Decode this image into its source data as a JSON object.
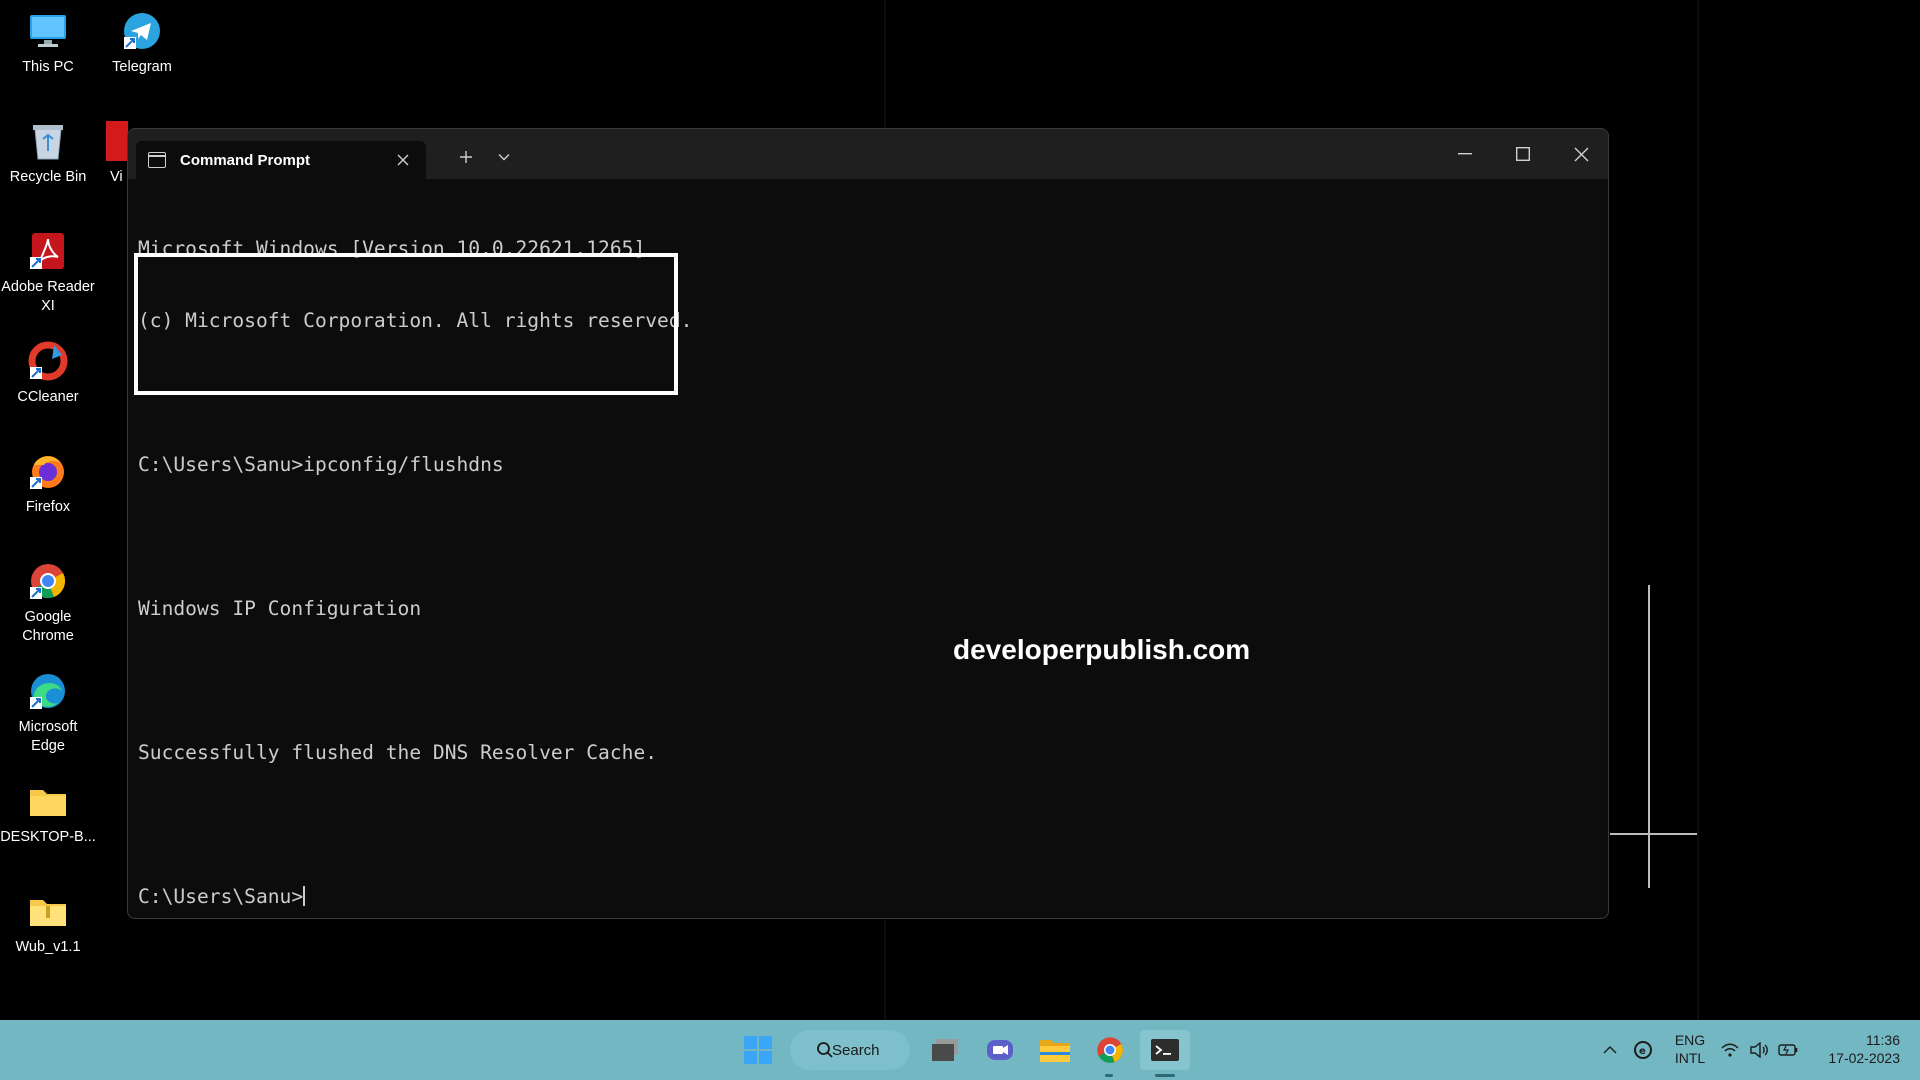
{
  "desktop": {
    "icons": [
      {
        "label": "This PC"
      },
      {
        "label": "Telegram"
      },
      {
        "label": "Recycle Bin"
      },
      {
        "label": "Vi"
      },
      {
        "label": "Adobe Reader XI"
      },
      {
        "label": "CCleaner"
      },
      {
        "label": "Firefox"
      },
      {
        "label": "Google Chrome"
      },
      {
        "label": "Microsoft Edge"
      },
      {
        "label": "DESKTOP-B..."
      },
      {
        "label": "Wub_v1.1"
      }
    ]
  },
  "terminal": {
    "tab_title": "Command Prompt",
    "lines": [
      "Microsoft Windows [Version 10.0.22621.1265]",
      "(c) Microsoft Corporation. All rights reserved.",
      "",
      "C:\\Users\\Sanu>ipconfig/flushdns",
      "",
      "Windows IP Configuration",
      "",
      "Successfully flushed the DNS Resolver Cache.",
      "",
      "C:\\Users\\Sanu>"
    ],
    "watermark": "developerpublish.com"
  },
  "taskbar": {
    "search_label": "Search",
    "lang_line1": "ENG",
    "lang_line2": "INTL",
    "time": "11:36",
    "date": "17-02-2023"
  },
  "colors": {
    "taskbar": "#73b7c3",
    "terminal_bg": "#0c0c0c",
    "titlebar": "#1f1f1f"
  }
}
